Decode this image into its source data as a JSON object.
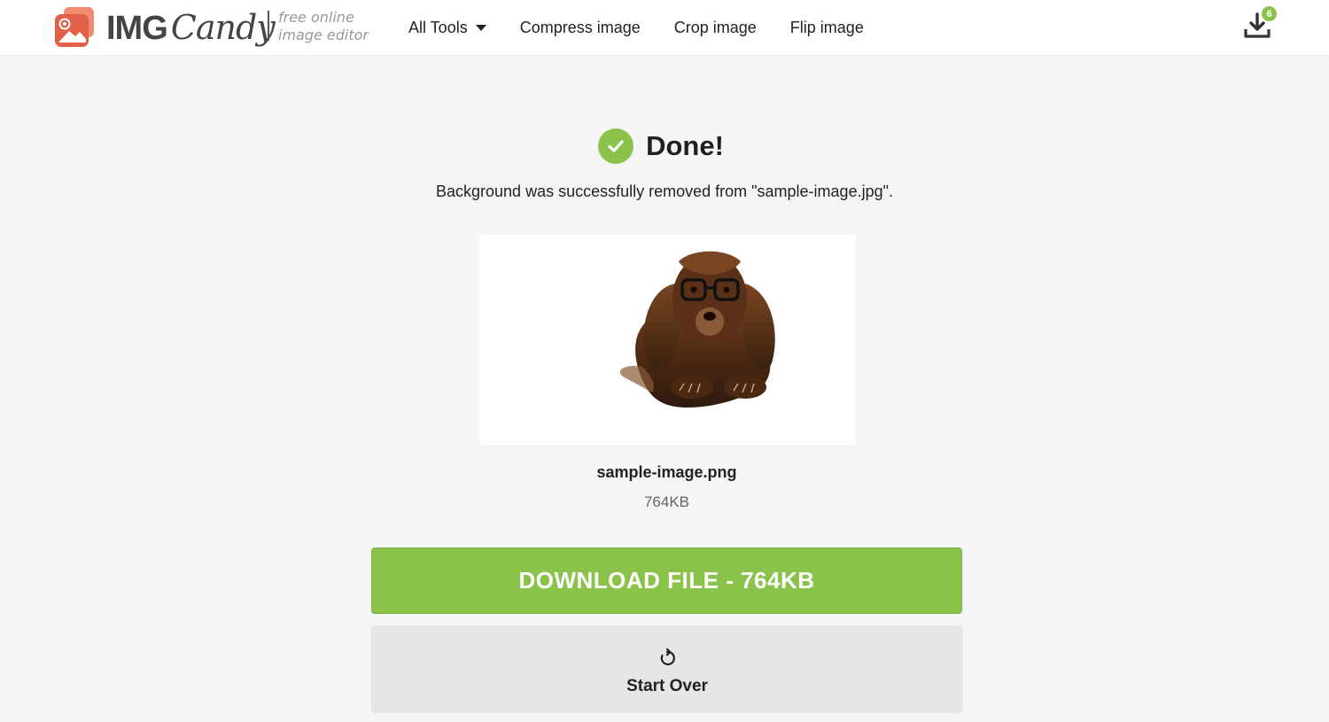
{
  "header": {
    "logo": {
      "word_img": "IMG",
      "word_candy": "Candy",
      "tagline_line1": "free online",
      "tagline_line2": "image editor"
    },
    "nav": [
      {
        "label": "All Tools",
        "has_dropdown": true
      },
      {
        "label": "Compress image"
      },
      {
        "label": "Crop image"
      },
      {
        "label": "Flip image"
      }
    ],
    "downloads": {
      "icon": "download-icon",
      "badge_count": "6"
    }
  },
  "result": {
    "status_icon": "check-circle-icon",
    "title": "Done!",
    "message": "Background was successfully removed from \"sample-image.jpg\".",
    "file": {
      "name": "sample-image.png",
      "size": "764KB"
    }
  },
  "actions": {
    "download_label": "DOWNLOAD FILE - 764KB",
    "start_over_label": "Start Over",
    "start_over_icon": "refresh-icon"
  },
  "colors": {
    "accent_green": "#8bc34a",
    "logo_red": "#e2604a",
    "page_bg": "#f5f5f5",
    "secondary_button": "#e6e6e6"
  }
}
